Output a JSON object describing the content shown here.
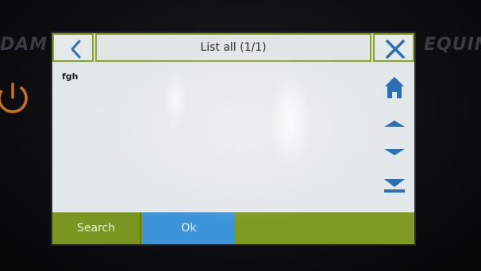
{
  "device": {
    "brand_left": "DAM",
    "brand_right": "EQUIN",
    "power_icon": "power-icon"
  },
  "header": {
    "title": "List all (1/1)",
    "back_icon": "chevron-left-icon",
    "close_icon": "close-icon"
  },
  "list": {
    "items": [
      {
        "label": "fgh"
      }
    ]
  },
  "nav": {
    "home_icon": "home-icon",
    "up_icon": "triangle-up-icon",
    "down_icon": "triangle-down-icon",
    "last_icon": "skip-to-end-icon"
  },
  "footer": {
    "search_label": "Search",
    "ok_label": "Ok"
  },
  "colors": {
    "accent_green": "#7f9a22",
    "accent_blue": "#3c95da",
    "icon_blue": "#2d6fb4",
    "screen_bg": "#e2e7e9"
  }
}
